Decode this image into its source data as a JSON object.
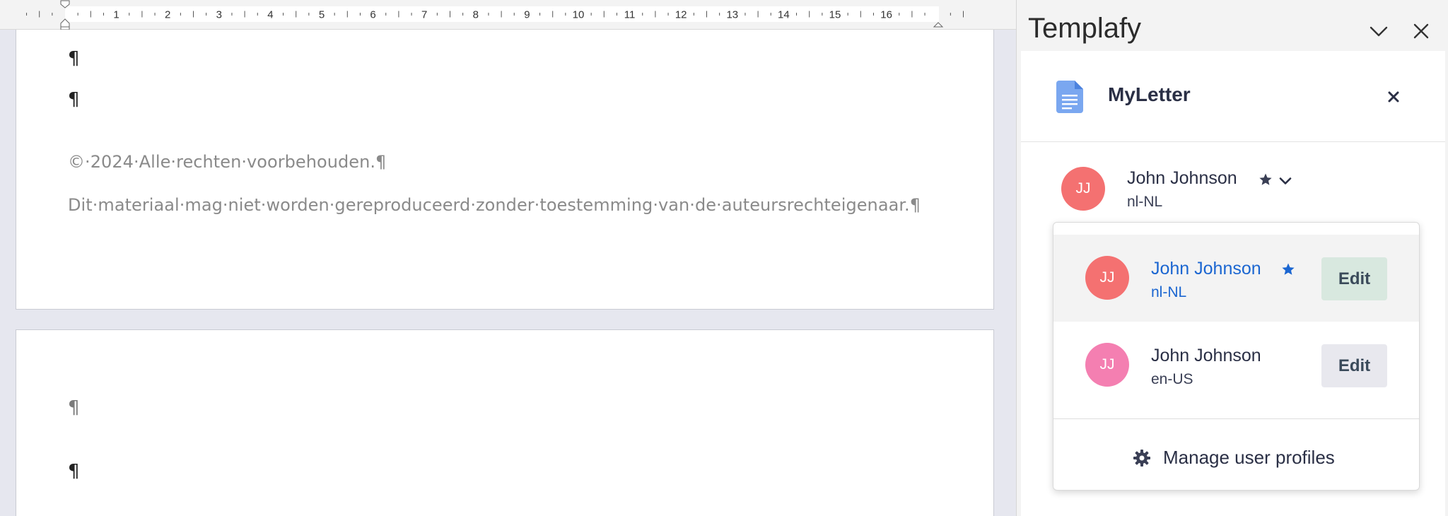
{
  "ruler": {
    "numbers": [
      "1",
      "2",
      "3",
      "4",
      "5",
      "6",
      "7",
      "8",
      "9",
      "10",
      "11",
      "12",
      "13",
      "14",
      "15",
      "16"
    ]
  },
  "document": {
    "page1": {
      "copyright_line": "©·2024·Alle·rechten·voorbehouden.¶",
      "notice_line": "Dit·materiaal·mag·niet·worden·gereproduceerd·zonder·toestemming·van·de·auteursrechteigenaar.¶",
      "pilcrow": "¶"
    },
    "page2": {
      "pilcrow": "¶"
    }
  },
  "pane": {
    "title": "Templafy",
    "collapse_icon": "chevron-down-icon",
    "close_icon": "close-icon",
    "document_name": "MyLetter",
    "document_icon": "document-icon",
    "current_profile": {
      "initials": "JJ",
      "name": "John Johnson",
      "locale": "nl-NL",
      "avatar_color": "#f47171"
    },
    "dropdown": {
      "options": [
        {
          "initials": "JJ",
          "name": "John Johnson",
          "locale": "nl-NL",
          "edit_label": "Edit",
          "avatar_color": "#f47171",
          "favorite": true,
          "selected": true
        },
        {
          "initials": "JJ",
          "name": "John Johnson",
          "locale": "en-US",
          "edit_label": "Edit",
          "avatar_color": "#f47fb1",
          "favorite": false,
          "selected": false
        }
      ],
      "manage_label": "Manage user profiles"
    }
  },
  "colors": {
    "accent_blue": "#1b66d1",
    "edit_selected_bg": "#d8e8df",
    "edit_bg": "#e8e8ee",
    "doc_icon_blue": "#7aa7f0"
  }
}
